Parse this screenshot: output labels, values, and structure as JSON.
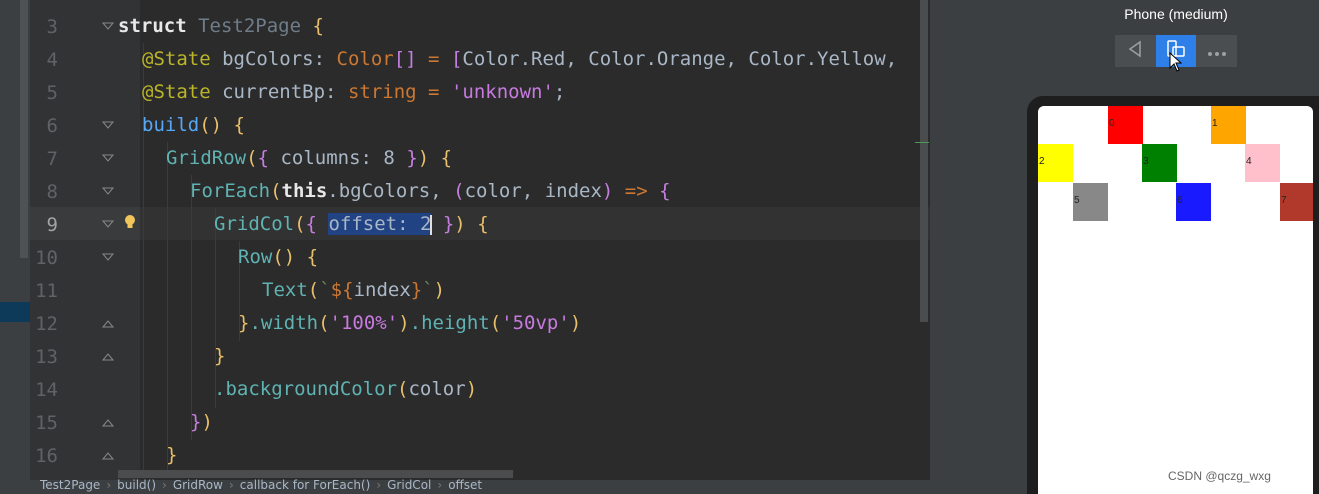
{
  "editor": {
    "lines": [
      {
        "num": "3"
      },
      {
        "num": "4"
      },
      {
        "num": "5"
      },
      {
        "num": "6"
      },
      {
        "num": "7"
      },
      {
        "num": "8"
      },
      {
        "num": "9"
      },
      {
        "num": "10"
      },
      {
        "num": "11"
      },
      {
        "num": "12"
      },
      {
        "num": "13"
      },
      {
        "num": "14"
      },
      {
        "num": "15"
      },
      {
        "num": "16"
      }
    ],
    "code": {
      "l3_struct": "struct",
      "l3_name": "Test2Page",
      "l4_dec": "@State",
      "l4_name": "bgColors",
      "l4_type": "Color",
      "l4_vals": [
        "Color.Red",
        "Color.Orange",
        "Color.Yellow"
      ],
      "l5_dec": "@State",
      "l5_name": "currentBp",
      "l5_type": "string",
      "l5_val": "'unknown'",
      "l6_fn": "build",
      "l7_fn": "GridRow",
      "l7_key": "columns",
      "l7_num": "8",
      "l8_fn": "ForEach",
      "l8_this": "this",
      "l8_prop": ".bgColors",
      "l8_p1": "color",
      "l8_p2": "index",
      "l9_fn": "GridCol",
      "l9_sel": "offset: 2",
      "l10_fn": "Row",
      "l11_fn": "Text",
      "l11_var": "index",
      "l12_w": ".width",
      "l12_wv": "'100%'",
      "l12_h": ".height",
      "l12_hv": "'50vp'",
      "l14_fn": ".backgroundColor",
      "l14_arg": "color"
    }
  },
  "breadcrumb": [
    "Test2Page",
    "build()",
    "GridRow",
    "callback for ForEach()",
    "GridCol",
    "offset"
  ],
  "preview": {
    "device_title": "Phone (medium)",
    "toolbar": {
      "back_icon": "back-triangle-icon",
      "device_icon": "device-switch-icon",
      "more_icon": "more-icon"
    },
    "cells": [
      {
        "label": "0",
        "color": "#ff0000"
      },
      {
        "label": "1",
        "color": "#ffa500"
      },
      {
        "label": "2",
        "color": "#ffff00"
      },
      {
        "label": "3",
        "color": "#008000"
      },
      {
        "label": "4",
        "color": "#ffc0cb"
      },
      {
        "label": "5",
        "color": "#888888"
      },
      {
        "label": "6",
        "color": "#1a1aff"
      },
      {
        "label": "7",
        "color": "#b0392b"
      }
    ]
  },
  "watermark": "CSDN @qczg_wxg"
}
